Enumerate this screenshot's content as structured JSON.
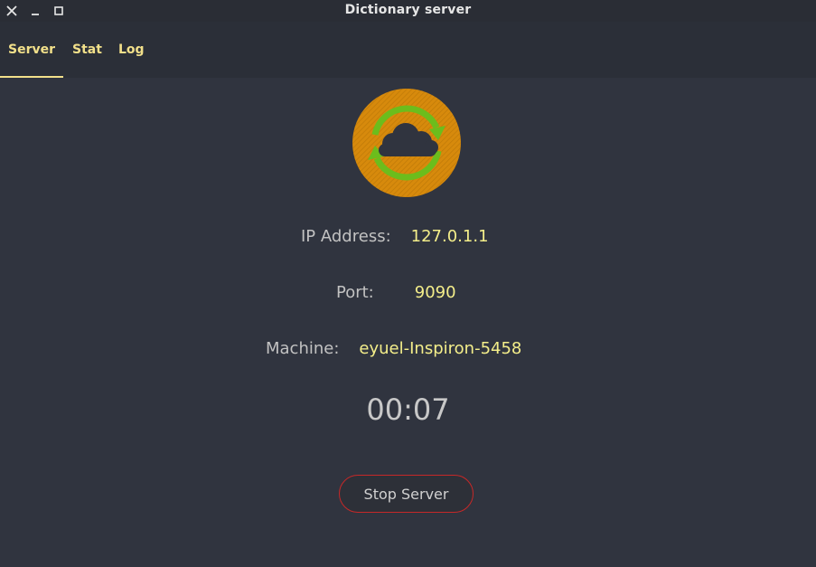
{
  "window": {
    "title": "Dictionary server",
    "controls": [
      "close-icon",
      "minimize-icon",
      "maximize-icon"
    ]
  },
  "tabs": [
    {
      "label": "Server",
      "active": true
    },
    {
      "label": "Stat",
      "active": false
    },
    {
      "label": "Log",
      "active": false
    }
  ],
  "server": {
    "ip_label": "IP Address:",
    "ip_value": "127.0.1.1",
    "port_label": "Port:",
    "port_value": "9090",
    "machine_label": "Machine:",
    "machine_value": "eyuel-Inspiron-5458",
    "timer": "00:07",
    "stop_button_label": "Stop Server",
    "logo_icon": "cloud-sync-icon"
  },
  "colors": {
    "background": "#30343f",
    "tabbar": "#2b2f38",
    "accent_yellow": "#f4ee8a",
    "label_gray": "#c2c2c2",
    "stop_border_red": "#c62828",
    "logo_orange": "#d78a0c",
    "logo_green": "#6cbd1c"
  }
}
